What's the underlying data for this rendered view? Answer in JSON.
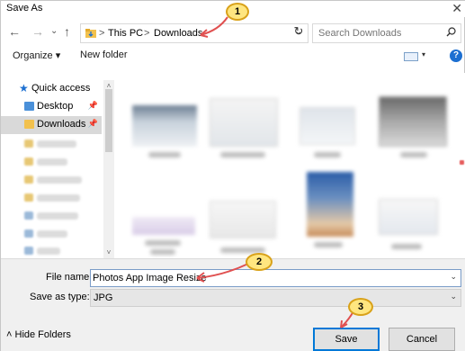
{
  "window": {
    "title": "Save As",
    "close_glyph": "✕"
  },
  "nav_buttons": {
    "back": "←",
    "forward": "→",
    "recent": "⌄",
    "up": "↑"
  },
  "address": {
    "crumbs": [
      "This PC",
      "Downloads"
    ],
    "separator": ">",
    "dropdown": "⌄",
    "refresh": "↻"
  },
  "search": {
    "placeholder": "Search Downloads",
    "icon": "search-icon"
  },
  "toolbar": {
    "organize_label": "Organize ▾",
    "new_folder_label": "New folder",
    "view_dropdown": "▾",
    "help": "?"
  },
  "sidebar": {
    "items": [
      {
        "label": "Quick access",
        "icon": "star-icon"
      },
      {
        "label": "Desktop",
        "icon": "folder-icon"
      },
      {
        "label": "Downloads",
        "icon": "download-folder-icon",
        "selected": true
      }
    ],
    "scroll_up": "˄",
    "scroll_down": "˅"
  },
  "file_name": {
    "label": "File name:",
    "value": "Photos App Image Resize"
  },
  "save_type": {
    "label": "Save as type:",
    "value": "JPG"
  },
  "footer": {
    "hide_folders_label": "Hide Folders",
    "hide_folders_glyph": "˄",
    "save_label": "Save",
    "cancel_label": "Cancel"
  },
  "annotations": [
    "1",
    "2",
    "3"
  ],
  "colors": {
    "accent": "#0078d7",
    "selected": "#d9d9d9",
    "annotation_fill": "#ffe680",
    "annotation_border": "#d9a21a",
    "arrow": "#e05050"
  }
}
